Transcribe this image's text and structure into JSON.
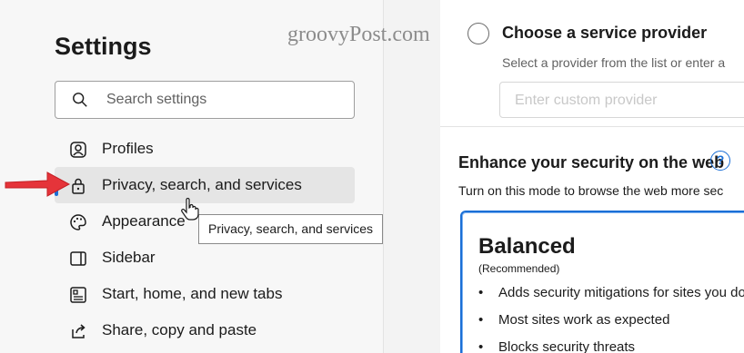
{
  "sidebar": {
    "title": "Settings",
    "search_placeholder": "Search settings",
    "items": [
      {
        "label": "Profiles",
        "icon": "profile-icon"
      },
      {
        "label": "Privacy, search, and services",
        "icon": "lock-icon",
        "active": true
      },
      {
        "label": "Appearance",
        "icon": "palette-icon"
      },
      {
        "label": "Sidebar",
        "icon": "sidebar-icon"
      },
      {
        "label": "Start, home, and new tabs",
        "icon": "home-icon"
      },
      {
        "label": "Share, copy and paste",
        "icon": "share-icon"
      }
    ],
    "tooltip": "Privacy, search, and services"
  },
  "content": {
    "watermark": "groovyPost.com",
    "provider": {
      "title": "Choose a service provider",
      "subtitle": "Select a provider from the list or enter a",
      "custom_placeholder": "Enter custom provider"
    },
    "security": {
      "title": "Enhance your security on the web",
      "help": "?",
      "subtitle": "Turn on this mode to browse the web more sec",
      "card": {
        "title": "Balanced",
        "recommended": "(Recommended)",
        "bullets": [
          "Adds security mitigations for sites you do",
          "Most sites work as expected",
          "Blocks security threats"
        ]
      }
    }
  },
  "colors": {
    "accent": "#1a6fd6",
    "arrow": "#e5343a"
  }
}
